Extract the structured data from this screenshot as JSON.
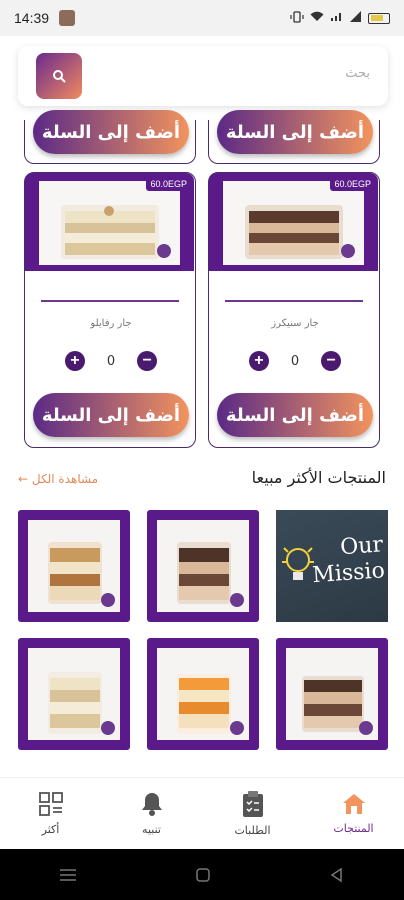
{
  "status": {
    "time": "14:39",
    "battery": "99"
  },
  "search": {
    "placeholder": "بحث"
  },
  "add_to_cart_label": "أضف إلى السلة",
  "products": [
    {
      "name": "جار سنيكرز",
      "price": "60.0EGP",
      "qty": "0"
    },
    {
      "name": "جار رفايلو",
      "price": "60.0EGP",
      "qty": "0"
    }
  ],
  "best_sellers": {
    "title": "المنتجات الأكثر مبيعا",
    "see_all": "مشاهدة الكل",
    "mission_text": "Our Missio"
  },
  "bottom_nav": {
    "items": [
      {
        "label": "المنتجات"
      },
      {
        "label": "الطلبات"
      },
      {
        "label": "تنبيه"
      },
      {
        "label": "أكثر"
      }
    ]
  },
  "colors": {
    "primary": "#5a1a8a",
    "accent": "#f2945e"
  }
}
